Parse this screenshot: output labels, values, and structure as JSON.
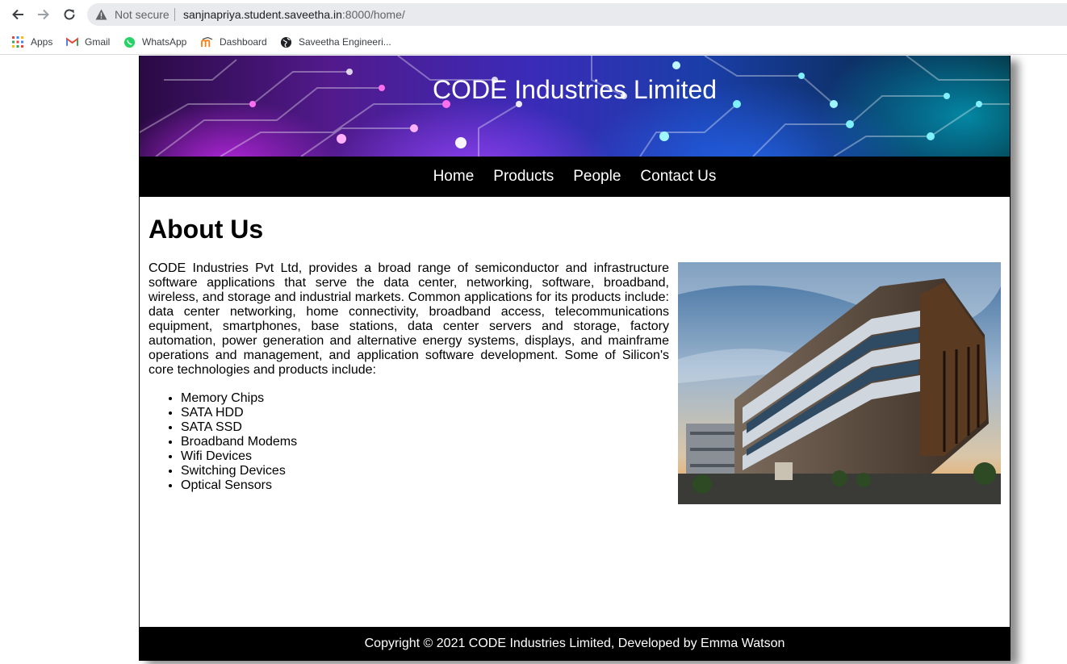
{
  "browser": {
    "security_label": "Not secure",
    "url_host": "sanjnapriya.student.saveetha.in",
    "url_path": ":8000/home/",
    "bookmarks": [
      {
        "label": "Apps",
        "icon": "apps-grid-icon"
      },
      {
        "label": "Gmail",
        "icon": "gmail-icon"
      },
      {
        "label": "WhatsApp",
        "icon": "whatsapp-icon"
      },
      {
        "label": "Dashboard",
        "icon": "moodle-icon"
      },
      {
        "label": "Saveetha Engineeri...",
        "icon": "globe-icon"
      }
    ]
  },
  "site": {
    "title": "CODE Industries Limited",
    "nav": [
      "Home",
      "Products",
      "People",
      "Contact Us"
    ]
  },
  "about": {
    "heading": "About Us",
    "paragraph": "CODE Industries Pvt Ltd, provides a broad range of semiconductor and infrastructure software applications that serve the data center, networking, software, broadband, wireless, and storage and industrial markets. Common applications for its products include: data center networking, home connectivity, broadband access, telecommunications equipment, smartphones, base stations, data center servers and storage, factory automation, power generation and alternative energy systems, displays, and mainframe operations and management, and application software development. Some of Silicon's core technologies and products include:",
    "products": [
      "Memory Chips",
      "SATA HDD",
      "SATA SSD",
      "Broadband Modems",
      "Wifi Devices",
      "Switching Devices",
      "Optical Sensors"
    ]
  },
  "footer": {
    "text": "Copyright © 2021 CODE Industries Limited, Developed by Emma Watson"
  },
  "colors": {
    "nav_bg": "#000000",
    "footer_bg": "#000000",
    "omnibox_bg": "#e8eaed"
  }
}
